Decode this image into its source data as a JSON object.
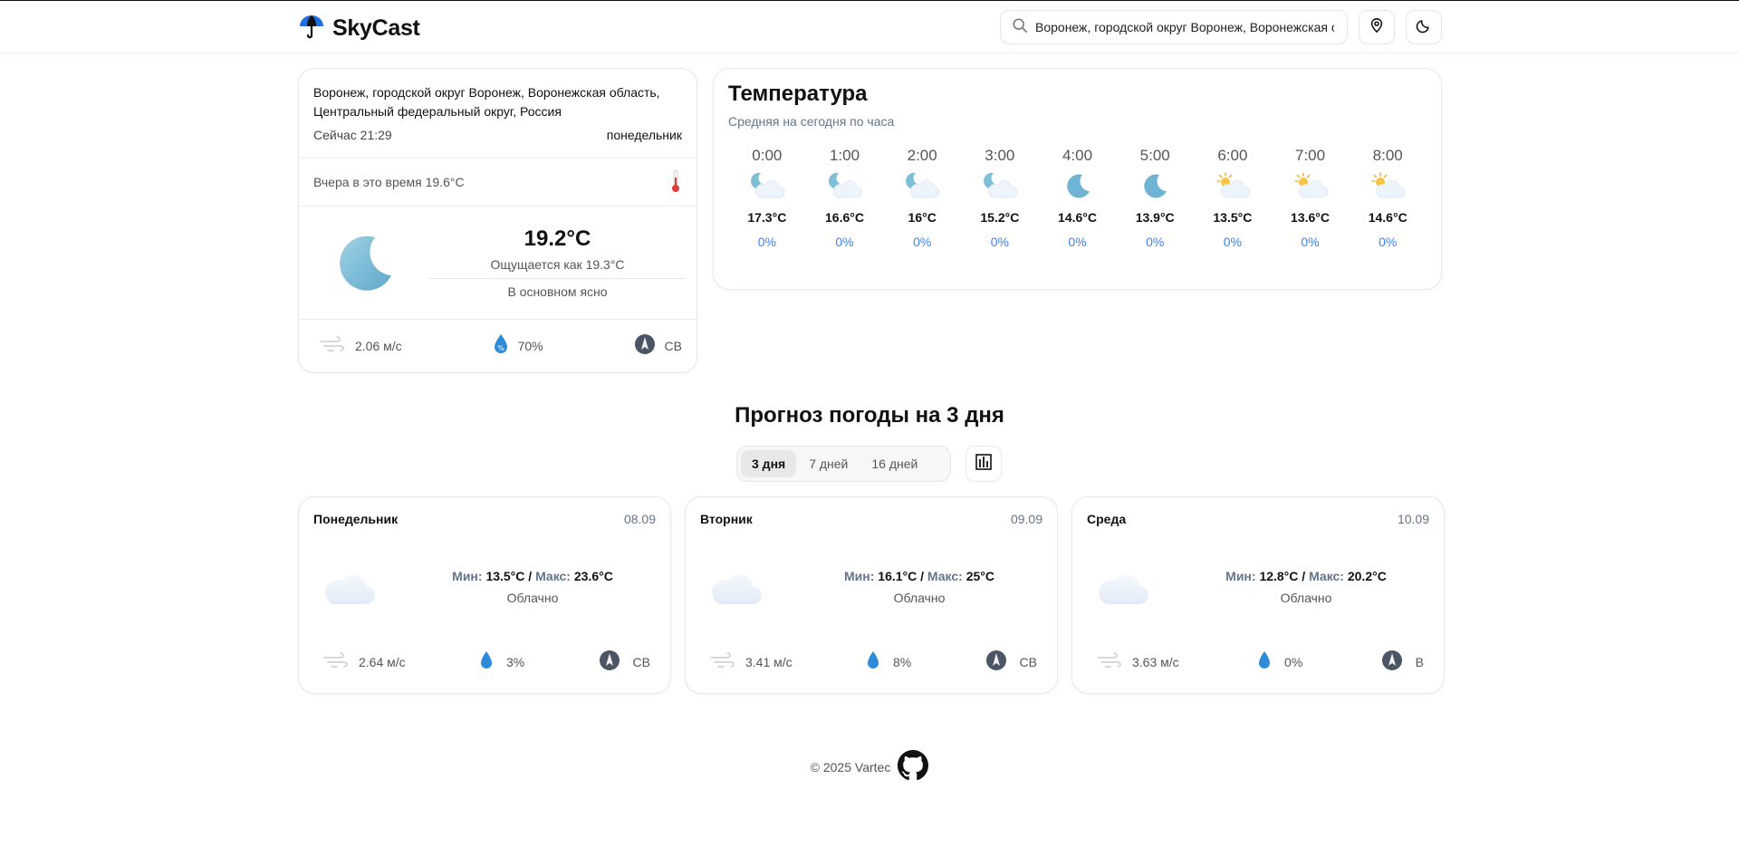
{
  "app": {
    "name": "SkyCast"
  },
  "search": {
    "value": "Воронеж, городской округ Воронеж, Воронежская область, Центральный федеральный округ, Россия",
    "placeholder": ""
  },
  "current": {
    "location": "Воронеж, городской округ Воронеж, Воронежская область, Центральный федеральный округ, Россия",
    "now": "Сейчас 21:29",
    "weekday": "понедельник",
    "yesterday": "Вчера в это время 19.6°C",
    "temp": "19.2°C",
    "feels_like": "Ощущается как 19.3°C",
    "description": "В основном ясно",
    "wind": "2.06 м/с",
    "humidity": "70%",
    "direction": "СВ",
    "icon": "moon-icon"
  },
  "hourly": {
    "title": "Температура",
    "subtitle": "Средняя на сегодня по часа",
    "items": [
      {
        "time": "0:00",
        "temp": "17.3°C",
        "precip": "0%",
        "icon": "moon-cloud-icon"
      },
      {
        "time": "1:00",
        "temp": "16.6°C",
        "precip": "0%",
        "icon": "moon-cloud-icon"
      },
      {
        "time": "2:00",
        "temp": "16°C",
        "precip": "0%",
        "icon": "moon-cloud-icon"
      },
      {
        "time": "3:00",
        "temp": "15.2°C",
        "precip": "0%",
        "icon": "moon-cloud-icon"
      },
      {
        "time": "4:00",
        "temp": "14.6°C",
        "precip": "0%",
        "icon": "moon-icon"
      },
      {
        "time": "5:00",
        "temp": "13.9°C",
        "precip": "0%",
        "icon": "moon-icon"
      },
      {
        "time": "6:00",
        "temp": "13.5°C",
        "precip": "0%",
        "icon": "sun-cloud-icon"
      },
      {
        "time": "7:00",
        "temp": "13.6°C",
        "precip": "0%",
        "icon": "sun-cloud-icon"
      },
      {
        "time": "8:00",
        "temp": "14.6°C",
        "precip": "0%",
        "icon": "sun-cloud-icon"
      }
    ]
  },
  "forecast": {
    "title": "Прогноз погоды на 3 дня",
    "tabs": [
      "3 дня",
      "7 дней",
      "16 дней"
    ],
    "min_label": "Мин:",
    "max_label": "Макс:",
    "days": [
      {
        "name": "Понедельник",
        "date": "08.09",
        "min": "13.5°C",
        "max": "23.6°C",
        "desc": "Облачно",
        "wind": "2.64 м/с",
        "precip": "3%",
        "dir": "СВ"
      },
      {
        "name": "Вторник",
        "date": "09.09",
        "min": "16.1°C",
        "max": "25°C",
        "desc": "Облачно",
        "wind": "3.41 м/с",
        "precip": "8%",
        "dir": "СВ"
      },
      {
        "name": "Среда",
        "date": "10.09",
        "min": "12.8°C",
        "max": "20.2°C",
        "desc": "Облачно",
        "wind": "3.63 м/с",
        "precip": "0%",
        "dir": "В"
      }
    ]
  },
  "footer": {
    "copyright": "© 2025 Vartec"
  },
  "colors": {
    "accent": "#3b82f6",
    "moon": "#7ec1d8",
    "muted": "#64748b"
  }
}
